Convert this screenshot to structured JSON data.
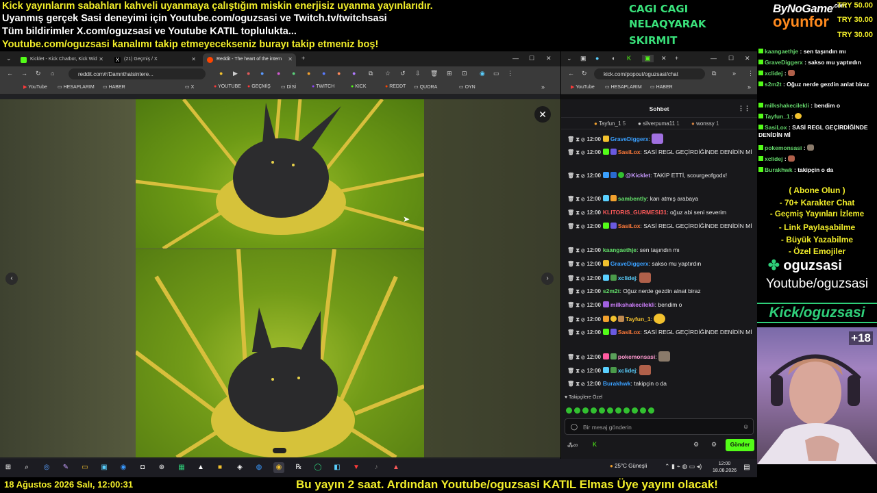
{
  "top_overlay": {
    "lines": [
      "Kick yayınlarım sabahları kahveli uyanmaya çalıştığım miskin enerjisiz uyanma yayınlarıdır.",
      "Uyanmış gerçek Sasi deneyimi için Youtube.com/oguzsasi ve Twitch.tv/twitchsasi",
      "Tüm bildirimler X.com/oguzsasi ve Youtube KATIL toplulukta...",
      "Youtube.com/oguzsasi kanalımı takip etmeyecekseniz burayı takip etmeniz boş!"
    ],
    "cagi": [
      "CAGI CAGI",
      "NELAQYARAK",
      "SKIRMIT"
    ],
    "logo_top": "ByNoGame",
    "logo_com": ".com",
    "logo_bottom": "oyunfor",
    "try_values": [
      "TRY 50.00",
      "TRY 30.00",
      "TRY 30.00"
    ]
  },
  "browser_left": {
    "tabs": [
      {
        "label": "Kicklet - Kick Chatbot, Kick Wid",
        "color": "#53fc18"
      },
      {
        "label": "(21) Geçmiş / X",
        "color": "#ffffff"
      },
      {
        "label": "Reddit - The heart of the intern",
        "color": "#ff4500"
      }
    ],
    "url": "reddit.com/r/Damnthatsintere...",
    "bookmarks": [
      "YouTube",
      "HESAPLARIM",
      "HABER",
      "X",
      "YOUTUBE",
      "GEÇMİŞ",
      "DİSİ",
      "TWITCH",
      "KICK",
      "REDDT",
      "QUORA",
      "OYN"
    ]
  },
  "browser_right": {
    "url": "kick.com/popout/oguzsasi/chat",
    "bookmarks": [
      "YouTube",
      "HESAPLARIM",
      "HABER"
    ],
    "chat_title": "Sohbet",
    "pinned": [
      {
        "name": "Tayfun_1",
        "count": "5"
      },
      {
        "name": "silverpuma11",
        "count": "1"
      },
      {
        "name": "wonssy",
        "count": "1"
      }
    ],
    "messages": [
      {
        "time": "12:00",
        "user": "GraveDiggerx",
        "color": "#3aa0ff",
        "text": ""
      },
      {
        "time": "12:00",
        "user": "SasiLox",
        "color": "#ff7a3a",
        "text": "SASİ REGL GEÇİRDİĞİNDE DENİDİN Mİ"
      },
      {
        "time": "12:00",
        "user": "@Kicklet",
        "color": "#c89bff",
        "text": "TAKİP ETTİ, scourgeofgodx!"
      },
      {
        "time": "12:00",
        "user": "sambently",
        "color": "#63e06a",
        "text": "karı atmış arabaya"
      },
      {
        "time": "12:00",
        "user": "KLITORIS_GURMESI31",
        "color": "#ff5a5a",
        "text": "oğuz abi seni severim"
      },
      {
        "time": "12:00",
        "user": "SasiLox",
        "color": "#ff7a3a",
        "text": "SASİ REGL GEÇİRDİĞİNDE DENİDİN Mİ"
      },
      {
        "time": "12:00",
        "user": "kaangaethje",
        "color": "#63e06a",
        "text": "sen taşındın mı"
      },
      {
        "time": "12:00",
        "user": "GraveDiggerx",
        "color": "#3aa0ff",
        "text": "sakso mu yaptırdın"
      },
      {
        "time": "12:00",
        "user": "xclidej",
        "color": "#5ad0ff",
        "text": ""
      },
      {
        "time": "12:00",
        "user": "s2m2t",
        "color": "#63e06a",
        "text": "Oğuz nerde gezdin alnat biraz"
      },
      {
        "time": "12:00",
        "user": "milkshakecilekli",
        "color": "#d080ff",
        "text": "bendim o"
      },
      {
        "time": "12:00",
        "user": "Tayfun_1",
        "color": "#f2c12e",
        "text": ""
      },
      {
        "time": "12:00",
        "user": "SasiLox",
        "color": "#ff7a3a",
        "text": "SASİ REGL GEÇİRDİĞİNDE DENİDİN Mİ"
      },
      {
        "time": "12:00",
        "user": "pokemonsasi",
        "color": "#ff9ad0",
        "text": ""
      },
      {
        "time": "12:00",
        "user": "xclidej",
        "color": "#5ad0ff",
        "text": ""
      },
      {
        "time": "12:00",
        "user": "Burakhwk",
        "color": "#3aa0ff",
        "text": "takipçin o da"
      }
    ],
    "followers_label": "Takipçilere Özel",
    "input_placeholder": "Bir mesaj gönderin",
    "send_label": "Gönder"
  },
  "right_overlay": {
    "messages": [
      {
        "user": "kaangaethje",
        "text": "sen taşındın mı"
      },
      {
        "user": "GraveDiggerx",
        "text": "sakso mu yaptırdın"
      },
      {
        "user": "xclidej",
        "text": ""
      },
      {
        "user": "s2m2t",
        "text": "Oğuz nerde gezdin anlat biraz"
      },
      {
        "user": "milkshakecilekli",
        "text": "bendim o"
      },
      {
        "user": "Tayfun_1",
        "text": ""
      },
      {
        "user": "SasiLox",
        "text": "SASİ REGL GEÇİRDİĞİNDE DENİDİN Mİ"
      },
      {
        "user": "pokemonsasi",
        "text": ""
      },
      {
        "user": "xclidej",
        "text": ""
      },
      {
        "user": "Burakhwk",
        "text": "takipçin o da"
      }
    ],
    "promo": [
      "( Abone Olun )",
      "- 70+ Karakter Chat",
      "- Geçmiş Yayınları İzleme",
      "- Link Paylaşabilme",
      "- Büyük Yazabilme",
      "- Özel Emojiler"
    ],
    "channel": "oguzsasi",
    "youtube": "Youtube/oguzsasi",
    "kick": "Kick/oguzsasi",
    "age": "+18"
  },
  "taskbar": {
    "weather": "25°C  Güneşli",
    "time": "12:00",
    "date": "18.08.2026"
  },
  "ticker": {
    "datetime": "18 Ağustos 2026 Salı, 12:00:31",
    "message": "Bu yayın 2 saat. Ardından Youtube/oguzsasi KATIL Elmas Üye yayını olacak!"
  }
}
